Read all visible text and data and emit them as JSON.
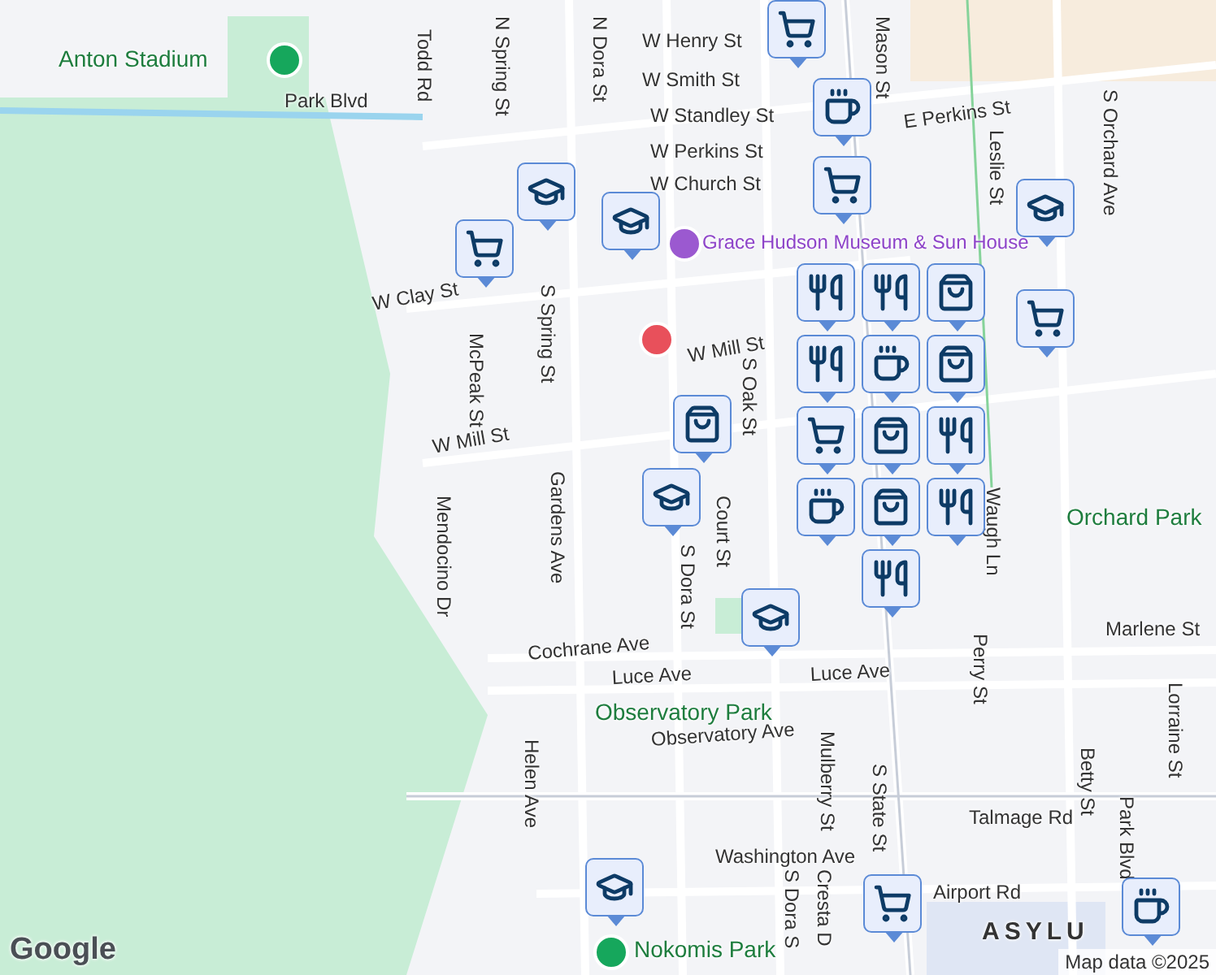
{
  "map": {
    "labels": [
      {
        "text": "Anton Stadium",
        "kind": "place"
      },
      {
        "text": "Park Blvd",
        "kind": "street"
      },
      {
        "text": "Todd Rd",
        "kind": "street"
      },
      {
        "text": "N Spring St",
        "kind": "street"
      },
      {
        "text": "N Dora St",
        "kind": "street"
      },
      {
        "text": "W Henry St",
        "kind": "street"
      },
      {
        "text": "W Smith St",
        "kind": "street"
      },
      {
        "text": "Mason St",
        "kind": "street"
      },
      {
        "text": "W Standley St",
        "kind": "street"
      },
      {
        "text": "E Perkins St",
        "kind": "street"
      },
      {
        "text": "W Perkins St",
        "kind": "street"
      },
      {
        "text": "W Church St",
        "kind": "street"
      },
      {
        "text": "Grace Hudson Museum & Sun House",
        "kind": "poi"
      },
      {
        "text": "W Clay St",
        "kind": "street"
      },
      {
        "text": "McPeak St",
        "kind": "street"
      },
      {
        "text": "S Spring St",
        "kind": "street"
      },
      {
        "text": "W Mill St",
        "kind": "street"
      },
      {
        "text": "W Mill St",
        "kind": "street"
      },
      {
        "text": "S Oak St",
        "kind": "street"
      },
      {
        "text": "Leslie St",
        "kind": "street"
      },
      {
        "text": "S Orchard Ave",
        "kind": "street"
      },
      {
        "text": "Waugh Ln",
        "kind": "street"
      },
      {
        "text": "Orchard Park",
        "kind": "place"
      },
      {
        "text": "Mendocino Dr",
        "kind": "street"
      },
      {
        "text": "Gardens Ave",
        "kind": "street"
      },
      {
        "text": "Court St",
        "kind": "street"
      },
      {
        "text": "S Dora St",
        "kind": "street"
      },
      {
        "text": "Cochrane Ave",
        "kind": "street"
      },
      {
        "text": "Luce Ave",
        "kind": "street"
      },
      {
        "text": "Luce Ave",
        "kind": "street"
      },
      {
        "text": "Observatory Park",
        "kind": "place"
      },
      {
        "text": "Observatory Ave",
        "kind": "street"
      },
      {
        "text": "Helen Ave",
        "kind": "street"
      },
      {
        "text": "Marlene St",
        "kind": "street"
      },
      {
        "text": "Lorraine St",
        "kind": "street"
      },
      {
        "text": "Perry St",
        "kind": "street"
      },
      {
        "text": "Betty St",
        "kind": "street"
      },
      {
        "text": "Talmage Rd",
        "kind": "street"
      },
      {
        "text": "S State St",
        "kind": "street"
      },
      {
        "text": "Mulberry St",
        "kind": "street"
      },
      {
        "text": "Park Blvd",
        "kind": "street"
      },
      {
        "text": "Washington Ave",
        "kind": "street"
      },
      {
        "text": "Airport Rd",
        "kind": "street"
      },
      {
        "text": "Nokomis Park",
        "kind": "place"
      },
      {
        "text": "S Dora S",
        "kind": "street"
      },
      {
        "text": "Cresta D",
        "kind": "street"
      },
      {
        "text": "ASYLU",
        "kind": "area"
      }
    ],
    "pins": [
      {
        "kind": "grocery"
      },
      {
        "kind": "coffee"
      },
      {
        "kind": "grocery"
      },
      {
        "kind": "school"
      },
      {
        "kind": "grocery"
      },
      {
        "kind": "school"
      },
      {
        "kind": "school"
      },
      {
        "kind": "restaurant"
      },
      {
        "kind": "restaurant"
      },
      {
        "kind": "shopping"
      },
      {
        "kind": "restaurant"
      },
      {
        "kind": "coffee"
      },
      {
        "kind": "grocery"
      },
      {
        "kind": "shopping"
      },
      {
        "kind": "shopping"
      },
      {
        "kind": "grocery"
      },
      {
        "kind": "shopping"
      },
      {
        "kind": "restaurant"
      },
      {
        "kind": "school"
      },
      {
        "kind": "coffee"
      },
      {
        "kind": "shopping"
      },
      {
        "kind": "restaurant"
      },
      {
        "kind": "restaurant"
      },
      {
        "kind": "school"
      },
      {
        "kind": "school"
      },
      {
        "kind": "grocery"
      },
      {
        "kind": "coffee"
      }
    ],
    "attribution": "Map data ©2025",
    "logo": "Google"
  }
}
